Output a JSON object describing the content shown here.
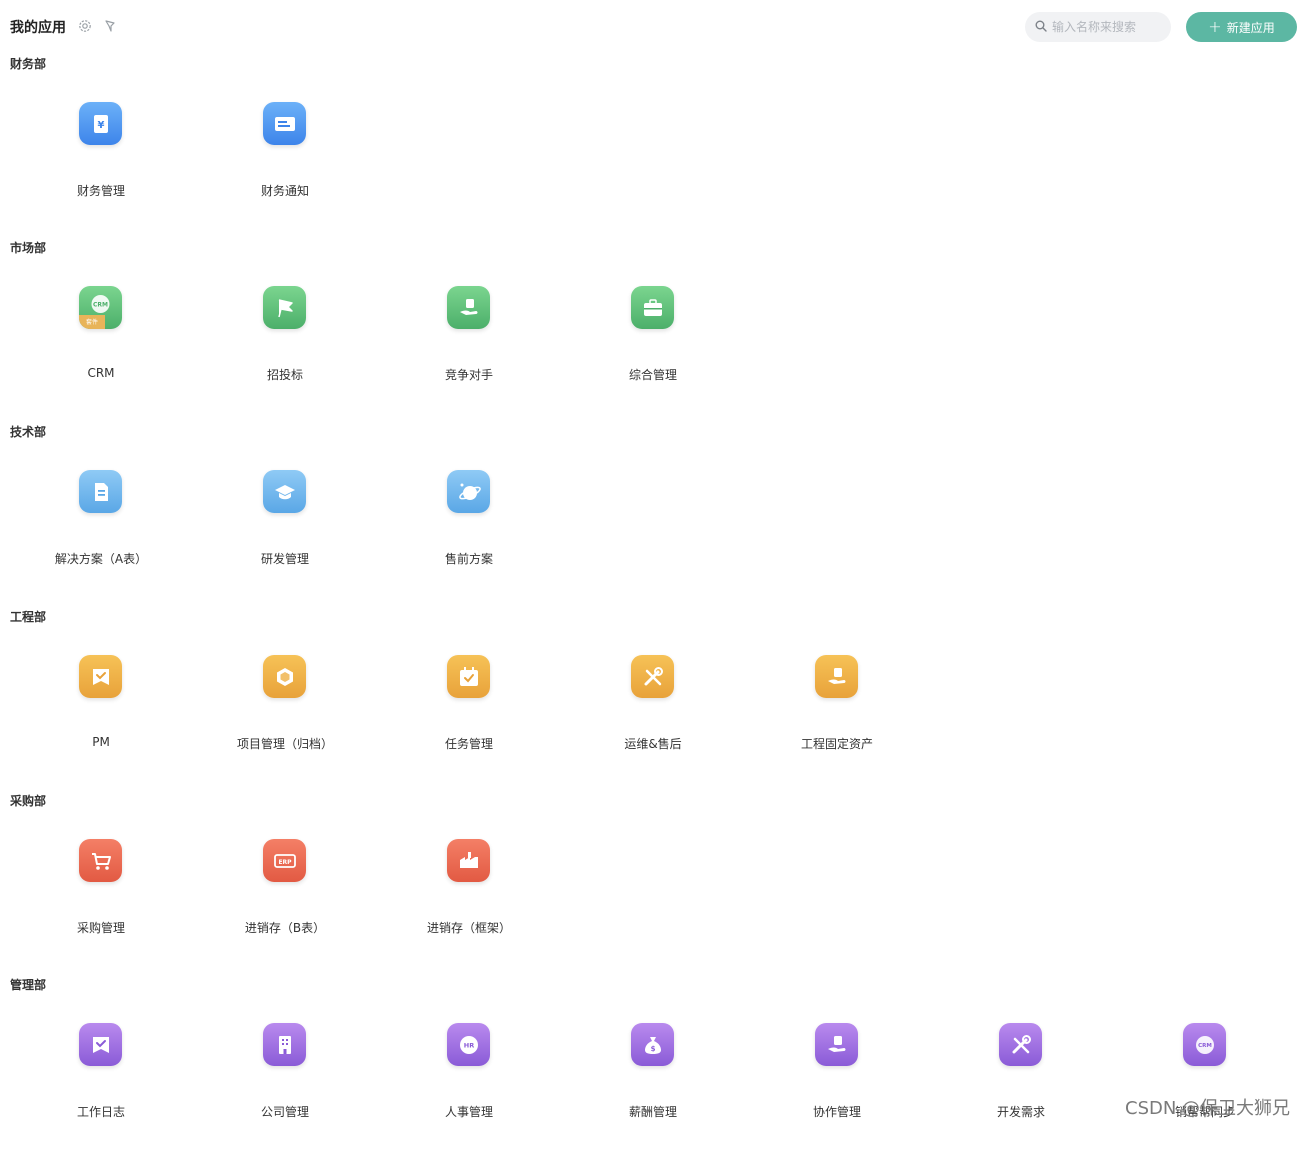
{
  "header": {
    "title": "我的应用",
    "search_placeholder": "输入名称来搜索",
    "new_button_label": "新建应用"
  },
  "sections": [
    {
      "name": "财务部",
      "apps": [
        {
          "label": "财务管理",
          "icon": "yen-document-icon"
        },
        {
          "label": "财务通知",
          "icon": "notice-card-icon"
        }
      ]
    },
    {
      "name": "市场部",
      "apps": [
        {
          "label": "CRM",
          "icon": "crm-kit-icon",
          "badge": "CRM",
          "tag": "套件"
        },
        {
          "label": "招投标",
          "icon": "flag-icon"
        },
        {
          "label": "竞争对手",
          "icon": "hand-bag-icon"
        },
        {
          "label": "综合管理",
          "icon": "briefcase-icon"
        }
      ]
    },
    {
      "name": "技术部",
      "apps": [
        {
          "label": "解决方案（A表）",
          "icon": "document-icon"
        },
        {
          "label": "研发管理",
          "icon": "graduation-cap-icon"
        },
        {
          "label": "售前方案",
          "icon": "planet-icon"
        }
      ]
    },
    {
      "name": "工程部",
      "apps": [
        {
          "label": "PM",
          "icon": "checked-ribbon-icon"
        },
        {
          "label": "项目管理（归档）",
          "icon": "hexagon-icon"
        },
        {
          "label": "任务管理",
          "icon": "calendar-check-icon"
        },
        {
          "label": "运维&售后",
          "icon": "tools-icon"
        },
        {
          "label": "工程固定资产",
          "icon": "hand-bag-icon"
        }
      ]
    },
    {
      "name": "采购部",
      "apps": [
        {
          "label": "采购管理",
          "icon": "cart-icon"
        },
        {
          "label": "进销存（B表）",
          "icon": "erp-icon",
          "badge": "ERP"
        },
        {
          "label": "进销存（框架）",
          "icon": "factory-icon"
        }
      ]
    },
    {
      "name": "管理部",
      "apps": [
        {
          "label": "工作日志",
          "icon": "checked-ribbon-icon"
        },
        {
          "label": "公司管理",
          "icon": "building-icon"
        },
        {
          "label": "人事管理",
          "icon": "hr-badge-icon",
          "badge": "HR"
        },
        {
          "label": "薪酬管理",
          "icon": "money-bag-icon"
        },
        {
          "label": "协作管理",
          "icon": "hand-bag-icon"
        },
        {
          "label": "开发需求",
          "icon": "tools-icon"
        },
        {
          "label": "销帮帮同步",
          "icon": "crm-badge-icon",
          "badge": "CRM"
        }
      ]
    }
  ],
  "watermark": "CSDN @保卫大狮兄",
  "colors": {
    "finance": "#3d84ea",
    "market": "#4caf6a",
    "tech": "#5aa7e6",
    "eng": "#e8a23a",
    "buy": "#e25a43",
    "mgmt": "#8a5bd7",
    "accent": "#5cb7a3"
  }
}
